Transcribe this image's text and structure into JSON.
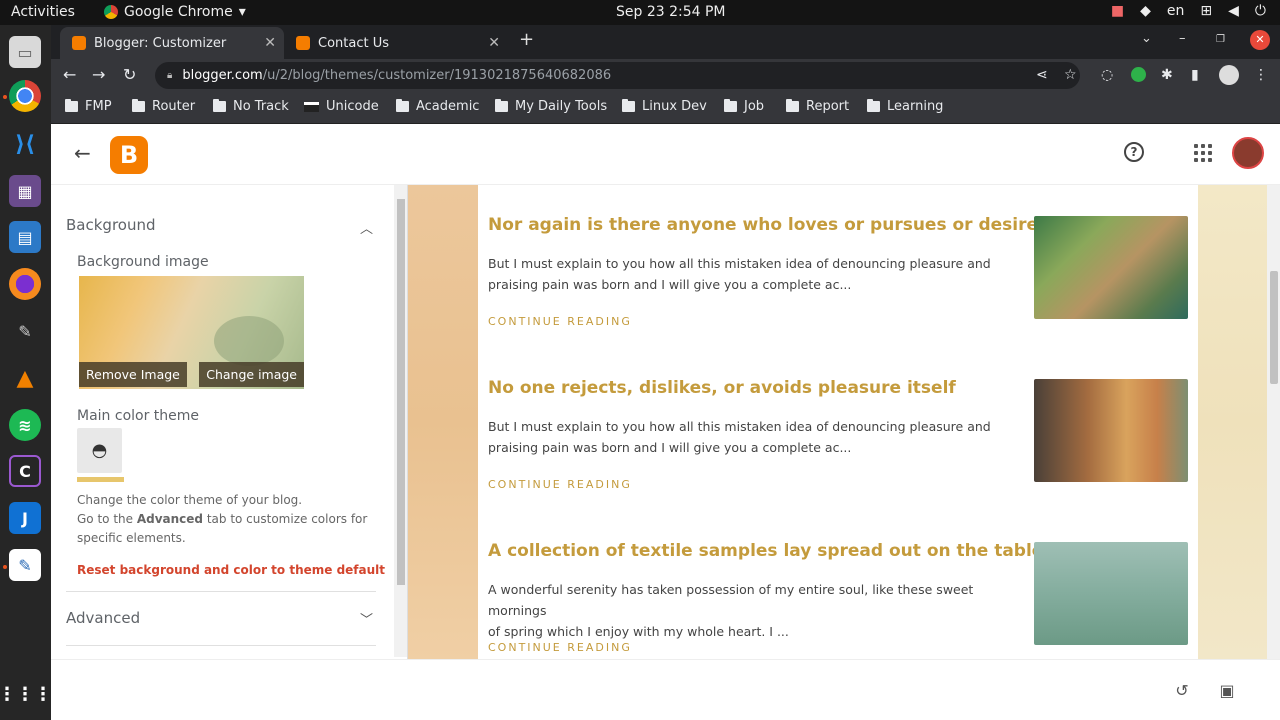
{
  "system": {
    "activities": "Activities",
    "app_name": "Google Chrome",
    "clock": "Sep 23  2:54 PM",
    "lang": "en"
  },
  "tabs": [
    {
      "title": "Blogger: Customizer",
      "active": true
    },
    {
      "title": "Contact Us",
      "active": false
    }
  ],
  "omnibox": {
    "host": "blogger.com",
    "path": "/u/2/blog/themes/customizer/1913021875640682086"
  },
  "bookmarks": [
    "FMP",
    "Router",
    "No Track",
    "Unicode",
    "Academic",
    "My Daily Tools",
    "Linux Dev",
    "Job",
    "Report",
    "Learning"
  ],
  "panel": {
    "background_title": "Background",
    "background_image_label": "Background image",
    "remove_image": "Remove Image",
    "change_image": "Change image",
    "main_color_label": "Main color theme",
    "desc_line1": "Change the color theme of your blog.",
    "desc_line2_pre": "Go to the ",
    "desc_line2_bold": "Advanced",
    "desc_line2_post": " tab to customize colors for",
    "desc_line3": "specific elements.",
    "reset_link": "Reset background and color to theme default",
    "advanced_title": "Advanced"
  },
  "posts": [
    {
      "title": "Nor again is there anyone who loves or pursues or desires",
      "excerpt_line1": "But I must explain to you how all this mistaken idea of denouncing pleasure and",
      "excerpt_line2": "praising pain was born and I will give you a complete ac...",
      "more": "CONTINUE READING"
    },
    {
      "title": "No one rejects, dislikes, or avoids pleasure itself",
      "excerpt_line1": "But I must explain to you how all this mistaken idea of denouncing pleasure and",
      "excerpt_line2": "praising pain was born and I will give you a complete ac...",
      "more": "CONTINUE READING"
    },
    {
      "title": "A collection of textile samples lay spread out on the table",
      "excerpt_line1": "A wonderful serenity has taken possession of my entire soul, like these sweet mornings",
      "excerpt_line2": "of spring which I enjoy with my whole heart. I ...",
      "more": "CONTINUE READING"
    }
  ],
  "colors": {
    "blogger_orange": "#f57d00",
    "post_title": "#c49b3c",
    "reset_link": "#d3452d"
  }
}
